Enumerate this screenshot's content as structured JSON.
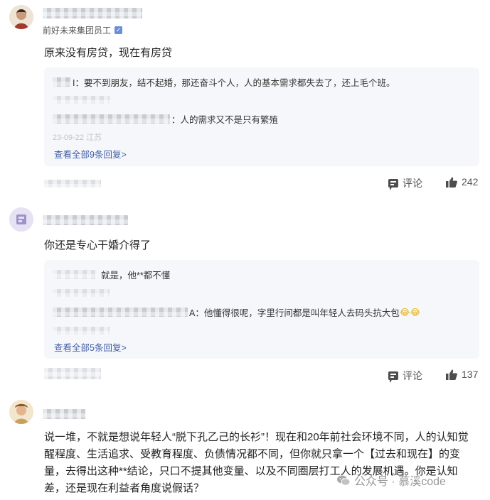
{
  "comment1": {
    "badge": "前好未来集团员工",
    "text": "原来没有房贷，现在有房贷",
    "replies": [
      {
        "text": "I：要不到朋友，结不起婚，那还奋斗个人，人的基本需求都失去了，还上毛个班。"
      },
      {
        "text": "：人的需求又不是只有繁殖",
        "meta": "23-09-22 江苏"
      }
    ],
    "view_all": "查看全部9条回复>",
    "action_comment": "评论",
    "likes": "242"
  },
  "comment2": {
    "text": "你还是专心干婚介得了",
    "replies": [
      {
        "text": "就是，他**都不懂"
      },
      {
        "text": "A：他懂得很呢，字里行间都是叫年轻人去码头抗大包",
        "emoji": "😂😂"
      }
    ],
    "view_all": "查看全部5条回复>",
    "action_comment": "评论",
    "likes": "137"
  },
  "comment3": {
    "text": "说一堆，不就是想说年轻人“脱下孔乙己的长衫”！现在和20年前社会环境不同，人的认知觉醒程度、生活追求、受教育程度、负债情况都不同，但你就只拿一个【过去和现在】的变量，去得出这种**结论，只口不提其他变量、以及不同圈层打工人的发展机遇。你是认知差，还是现在利益者角度说假话？"
  },
  "watermark": "公众号 · 慕溪code"
}
